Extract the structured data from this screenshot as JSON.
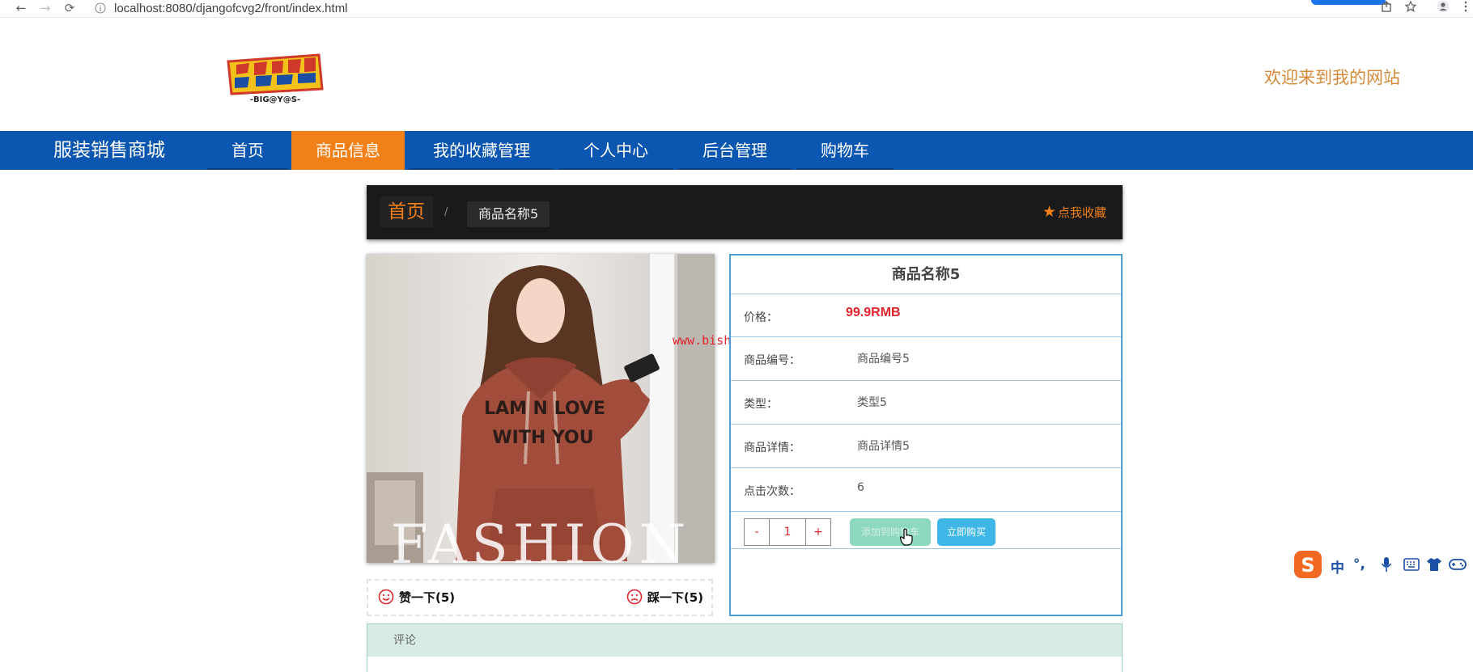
{
  "browser": {
    "url": "localhost:8080/djangofcvg2/front/index.html",
    "back_icon": "←",
    "forward_icon": "→",
    "reload_icon": "⟳",
    "info_icon": "i"
  },
  "header": {
    "welcome_text": "欢迎来到我的网站"
  },
  "nav": {
    "site_title": "服装销售商城",
    "items": [
      {
        "label": "首页"
      },
      {
        "label": "商品信息"
      },
      {
        "label": "我的收藏管理"
      },
      {
        "label": "个人中心"
      },
      {
        "label": "后台管理"
      },
      {
        "label": "购物车"
      }
    ],
    "active_index": 1
  },
  "breadcrumb": {
    "home": "首页",
    "separator": "/",
    "current": "商品名称5",
    "favorite_label": "点我收藏"
  },
  "image": {
    "overlay_text": "FASHION",
    "shirt_text_line1": "LAM N LOVE",
    "shirt_text_line2": "WITH YOU"
  },
  "votes": {
    "like_label": "赞一下(5)",
    "dislike_label": "踩一下(5)"
  },
  "product": {
    "name": "商品名称5",
    "price_label": "价格：",
    "price_value": "99.9RMB",
    "code_label": "商品编号：",
    "code_value": "商品编号5",
    "type_label": "类型：",
    "type_value": "类型5",
    "detail_label": "商品详情：",
    "detail_value": "商品详情5",
    "clicks_label": "点击次数：",
    "clicks_value": "6"
  },
  "actions": {
    "minus": "-",
    "quantity": "1",
    "plus": "+",
    "add_to_cart": "添加到购物车",
    "buy_now": "立即购买"
  },
  "watermark": "www.bishebang.site",
  "comments": {
    "title": "评论"
  },
  "ime": {
    "lang": "中",
    "punct": "°,"
  },
  "colors": {
    "nav_bg": "#0b56b0",
    "nav_active": "#f08017",
    "price": "#e0242b",
    "welcome": "#d58a3a",
    "detail_border": "#4da1d8"
  }
}
